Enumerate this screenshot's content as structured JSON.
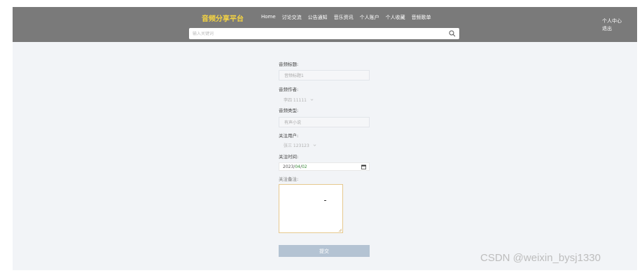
{
  "header": {
    "brand": "音频分享平台",
    "nav": [
      "Home",
      "讨论交流",
      "公告通知",
      "音乐资讯",
      "个人账户",
      "个人收藏",
      "音频歌单"
    ],
    "user_menu": [
      "个人中心",
      "退出"
    ],
    "search_placeholder": "输入关键词"
  },
  "form": {
    "title_label": "音频标题:",
    "title_value": "音频标题1",
    "author_label": "音频作者:",
    "author_value": "李四 11111",
    "type_label": "音频类型:",
    "type_value": "有声小说",
    "follow_user_label": "关注用户:",
    "follow_user_value": "张三 123123",
    "follow_time_label": "关注时间:",
    "follow_date_year": "2023",
    "follow_date_month": "04",
    "follow_date_day": "02",
    "remark_label": "关注备注:",
    "submit_label": "提交"
  },
  "watermark": "CSDN @weixin_bysj1330"
}
